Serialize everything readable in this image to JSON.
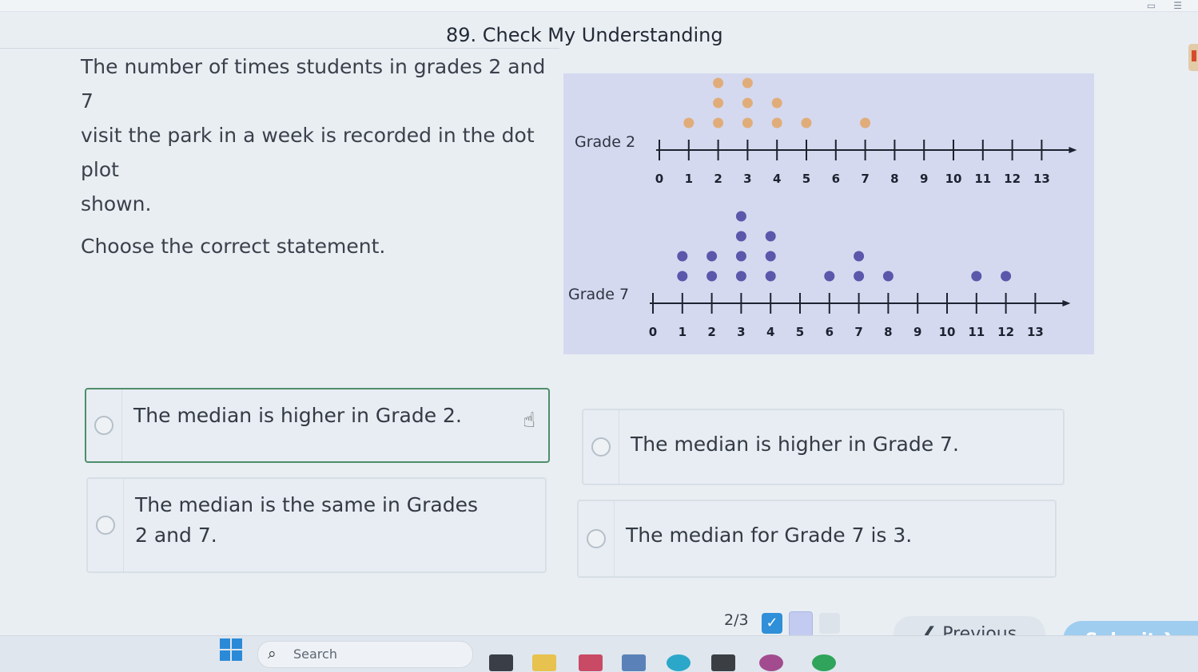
{
  "header": {
    "title": "89. Check My Understanding"
  },
  "question": {
    "prompt_lines": [
      "The number of times students in grades 2 and 7",
      "visit the park in a week is recorded in the dot plot",
      "shown."
    ],
    "instruction": "Choose the correct statement."
  },
  "chart_data": [
    {
      "type": "scatter",
      "subtype": "dot_plot",
      "label": "Grade 2",
      "axis": {
        "min": 0,
        "max": 13,
        "ticks": [
          0,
          1,
          2,
          3,
          4,
          5,
          6,
          7,
          8,
          9,
          10,
          11,
          12,
          13
        ]
      },
      "dot_color": "#e0ad7a",
      "counts": {
        "1": 1,
        "2": 3,
        "3": 3,
        "4": 2,
        "5": 1,
        "7": 1
      }
    },
    {
      "type": "scatter",
      "subtype": "dot_plot",
      "label": "Grade 7",
      "axis": {
        "min": 0,
        "max": 13,
        "ticks": [
          0,
          1,
          2,
          3,
          4,
          5,
          6,
          7,
          8,
          9,
          10,
          11,
          12,
          13
        ]
      },
      "dot_color": "#5b57ab",
      "counts": {
        "1": 2,
        "2": 2,
        "3": 4,
        "4": 3,
        "6": 1,
        "7": 2,
        "8": 1,
        "11": 1,
        "12": 1
      }
    }
  ],
  "options": [
    {
      "label": "The median is higher in Grade 2.",
      "selected": true
    },
    {
      "label": "The median is higher in Grade 7.",
      "selected": false
    },
    {
      "label": "The median is the same in Grades 2 and 7.",
      "selected": false
    },
    {
      "label": "The median for Grade 7 is 3.",
      "selected": false
    }
  ],
  "footer": {
    "progress": "2/3",
    "done_mark": "✓",
    "previous_label": "Previous",
    "previous_chevron": "❮",
    "submit_label": "Submit",
    "submit_chevron": "❯"
  },
  "taskbar": {
    "search_placeholder": "Search",
    "search_icon": "⌕"
  },
  "colors": {
    "selected_border": "#4e8e69",
    "submit_bg": "#9ecdf0",
    "panel_bg": "#d5d9ef"
  }
}
